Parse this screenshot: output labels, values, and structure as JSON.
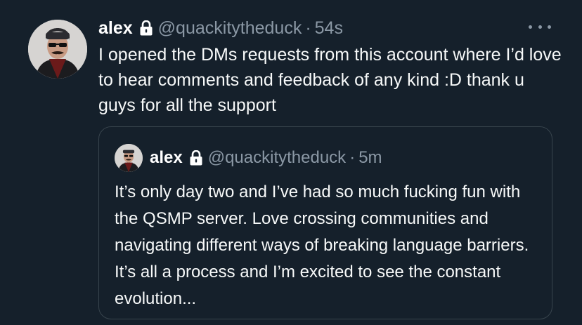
{
  "colors": {
    "background": "#15202b",
    "primary_text": "#f7f9f9",
    "secondary_text": "#8b98a5",
    "border": "#38444d"
  },
  "tweet": {
    "author": {
      "name": "alex",
      "handle": "@quackitytheduck",
      "protected_icon": "lock-icon",
      "avatar_icon": "profile-avatar"
    },
    "separator": "·",
    "time": "54s",
    "more_icon": "more-options-icon",
    "text": "I opened the DMs requests from this account where I’d love to hear comments and feedback of any kind :D thank u guys for all the support"
  },
  "quoted_tweet": {
    "author": {
      "name": "alex",
      "handle": "@quackitytheduck",
      "protected_icon": "lock-icon"
    },
    "separator": "·",
    "time": "5m",
    "text": "It’s only day two and I’ve had so much fucking fun with the QSMP server. Love crossing communities and navigating different ways of breaking language barriers. It’s all a process and I’m excited to see the constant evolution..."
  }
}
